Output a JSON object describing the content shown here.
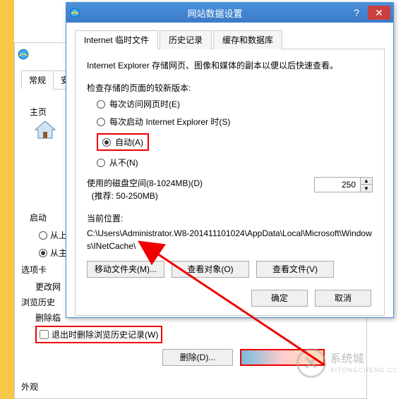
{
  "underlying": {
    "tab_general": "常规",
    "tab_security": "安",
    "home_label": "主页",
    "boot_label": "启动",
    "radio_last": "从上",
    "radio_home": "从主",
    "tabcard_label": "选项卡",
    "tabcard_text": "更改网",
    "history_label": "浏览历史",
    "history_text": "删除临",
    "exit_delete_label": "退出时删除浏览历史记录(W)",
    "delete_btn": "删除(D)...",
    "appearance": "外观"
  },
  "dialog": {
    "title": "网站数据设置",
    "tabs": {
      "temp": "Internet 临时文件",
      "history": "历史记录",
      "cache": "缓存和数据库"
    },
    "description": "Internet Explorer 存储网页、图像和媒体的副本以便以后快速查看。",
    "check_newer_label": "检查存储的页面的较新版本:",
    "radios": {
      "every_visit": "每次访问网页时(E)",
      "every_start": "每次启动 Internet Explorer 时(S)",
      "auto": "自动(A)",
      "never": "从不(N)"
    },
    "disk_label_main": "使用的磁盘空间(8-1024MB)(D)",
    "disk_label_sub": "(推荐: 50-250MB)",
    "disk_value": "250",
    "location_label": "当前位置:",
    "location_path": "C:\\Users\\Administrator.W8-201411101024\\AppData\\Local\\Microsoft\\Windows\\INetCache\\",
    "buttons": {
      "move_folder": "移动文件夹(M)...",
      "view_objects": "查看对象(O)",
      "view_files": "查看文件(V)",
      "ok": "确定",
      "cancel": "取消"
    }
  },
  "watermark": {
    "brand": "系统城",
    "url": "XITONGCHENG.CC"
  }
}
